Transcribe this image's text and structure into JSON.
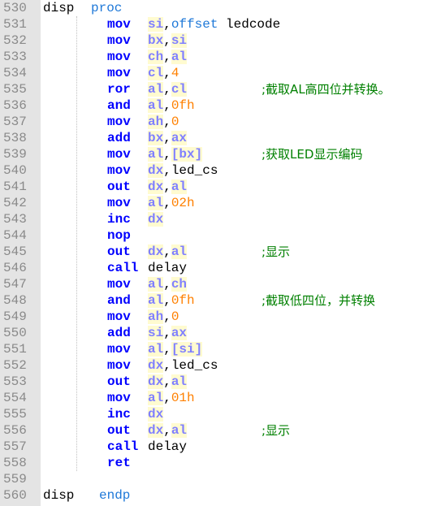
{
  "colors": {
    "gutter_bg": "#e4e4e4",
    "line_number": "#8a8a8a",
    "keyword": "#0000ff",
    "register": "#8080ff",
    "register_highlight": "#fffbd0",
    "number": "#ff8000",
    "directive": "#1e78d8",
    "comment": "#008000"
  },
  "lines": [
    {
      "n": "530",
      "label": "disp",
      "directive": "proc"
    },
    {
      "n": "531",
      "op": "mov",
      "tokens": [
        {
          "t": "reg",
          "v": "si"
        },
        {
          "t": "punct",
          "v": ","
        },
        {
          "t": "dir",
          "v": "offset"
        },
        {
          "t": "plain",
          "v": " ledcode"
        }
      ]
    },
    {
      "n": "532",
      "op": "mov",
      "tokens": [
        {
          "t": "reg",
          "v": "bx"
        },
        {
          "t": "punct",
          "v": ","
        },
        {
          "t": "reg",
          "v": "si"
        }
      ]
    },
    {
      "n": "533",
      "op": "mov",
      "tokens": [
        {
          "t": "reg",
          "v": "ch"
        },
        {
          "t": "punct",
          "v": ","
        },
        {
          "t": "reg",
          "v": "al"
        }
      ]
    },
    {
      "n": "534",
      "op": "mov",
      "tokens": [
        {
          "t": "reg",
          "v": "cl"
        },
        {
          "t": "punct",
          "v": ","
        },
        {
          "t": "num",
          "v": "4"
        }
      ]
    },
    {
      "n": "535",
      "op": "ror",
      "tokens": [
        {
          "t": "reg",
          "v": "al"
        },
        {
          "t": "punct",
          "v": ","
        },
        {
          "t": "reg",
          "v": "cl"
        }
      ],
      "comment": ";截取AL高四位并转换。"
    },
    {
      "n": "536",
      "op": "and",
      "tokens": [
        {
          "t": "reg",
          "v": "al"
        },
        {
          "t": "punct",
          "v": ","
        },
        {
          "t": "num",
          "v": "0fh"
        }
      ]
    },
    {
      "n": "537",
      "op": "mov",
      "tokens": [
        {
          "t": "reg",
          "v": "ah"
        },
        {
          "t": "punct",
          "v": ","
        },
        {
          "t": "num",
          "v": "0"
        }
      ]
    },
    {
      "n": "538",
      "op": "add",
      "tokens": [
        {
          "t": "reg",
          "v": "bx"
        },
        {
          "t": "punct",
          "v": ","
        },
        {
          "t": "reg",
          "v": "ax"
        }
      ]
    },
    {
      "n": "539",
      "op": "mov",
      "tokens": [
        {
          "t": "reg",
          "v": "al"
        },
        {
          "t": "punct",
          "v": ","
        },
        {
          "t": "reg",
          "v": "[bx]"
        }
      ],
      "comment": ";获取LED显示编码"
    },
    {
      "n": "540",
      "op": "mov",
      "tokens": [
        {
          "t": "reg",
          "v": "dx"
        },
        {
          "t": "punct",
          "v": ","
        },
        {
          "t": "plain",
          "v": "led_cs"
        }
      ]
    },
    {
      "n": "541",
      "op": "out",
      "tokens": [
        {
          "t": "reg",
          "v": "dx"
        },
        {
          "t": "punct",
          "v": ","
        },
        {
          "t": "reg",
          "v": "al"
        }
      ]
    },
    {
      "n": "542",
      "op": "mov",
      "tokens": [
        {
          "t": "reg",
          "v": "al"
        },
        {
          "t": "punct",
          "v": ","
        },
        {
          "t": "num",
          "v": "02h"
        }
      ]
    },
    {
      "n": "543",
      "op": "inc",
      "tokens": [
        {
          "t": "reg",
          "v": "dx"
        }
      ]
    },
    {
      "n": "544",
      "op": "nop",
      "tokens": []
    },
    {
      "n": "545",
      "op": "out",
      "tokens": [
        {
          "t": "reg",
          "v": "dx"
        },
        {
          "t": "punct",
          "v": ","
        },
        {
          "t": "reg",
          "v": "al"
        }
      ],
      "comment": ";显示"
    },
    {
      "n": "546",
      "op": "call",
      "tokens": [
        {
          "t": "plain",
          "v": "delay"
        }
      ]
    },
    {
      "n": "547",
      "op": "mov",
      "tokens": [
        {
          "t": "reg",
          "v": "al"
        },
        {
          "t": "punct",
          "v": ","
        },
        {
          "t": "reg",
          "v": "ch"
        }
      ]
    },
    {
      "n": "548",
      "op": "and",
      "tokens": [
        {
          "t": "reg",
          "v": "al"
        },
        {
          "t": "punct",
          "v": ","
        },
        {
          "t": "num",
          "v": "0fh"
        }
      ],
      "comment": ";截取低四位，并转换"
    },
    {
      "n": "549",
      "op": "mov",
      "tokens": [
        {
          "t": "reg",
          "v": "ah"
        },
        {
          "t": "punct",
          "v": ","
        },
        {
          "t": "num",
          "v": "0"
        }
      ]
    },
    {
      "n": "550",
      "op": "add",
      "tokens": [
        {
          "t": "reg",
          "v": "si"
        },
        {
          "t": "punct",
          "v": ","
        },
        {
          "t": "reg",
          "v": "ax"
        }
      ]
    },
    {
      "n": "551",
      "op": "mov",
      "tokens": [
        {
          "t": "reg",
          "v": "al"
        },
        {
          "t": "punct",
          "v": ","
        },
        {
          "t": "reg",
          "v": "[si]"
        }
      ]
    },
    {
      "n": "552",
      "op": "mov",
      "tokens": [
        {
          "t": "reg",
          "v": "dx"
        },
        {
          "t": "punct",
          "v": ","
        },
        {
          "t": "plain",
          "v": "led_cs"
        }
      ]
    },
    {
      "n": "553",
      "op": "out",
      "tokens": [
        {
          "t": "reg",
          "v": "dx"
        },
        {
          "t": "punct",
          "v": ","
        },
        {
          "t": "reg",
          "v": "al"
        }
      ]
    },
    {
      "n": "554",
      "op": "mov",
      "tokens": [
        {
          "t": "reg",
          "v": "al"
        },
        {
          "t": "punct",
          "v": ","
        },
        {
          "t": "num",
          "v": "01h"
        }
      ]
    },
    {
      "n": "555",
      "op": "inc",
      "tokens": [
        {
          "t": "reg",
          "v": "dx"
        }
      ]
    },
    {
      "n": "556",
      "op": "out",
      "tokens": [
        {
          "t": "reg",
          "v": "dx"
        },
        {
          "t": "punct",
          "v": ","
        },
        {
          "t": "reg",
          "v": "al"
        }
      ],
      "comment": ";显示"
    },
    {
      "n": "557",
      "op": "call",
      "tokens": [
        {
          "t": "plain",
          "v": "delay"
        }
      ]
    },
    {
      "n": "558",
      "op": "ret",
      "tokens": []
    },
    {
      "n": "559"
    },
    {
      "n": "560",
      "label": "disp",
      "directive": "endp",
      "end": true
    }
  ]
}
